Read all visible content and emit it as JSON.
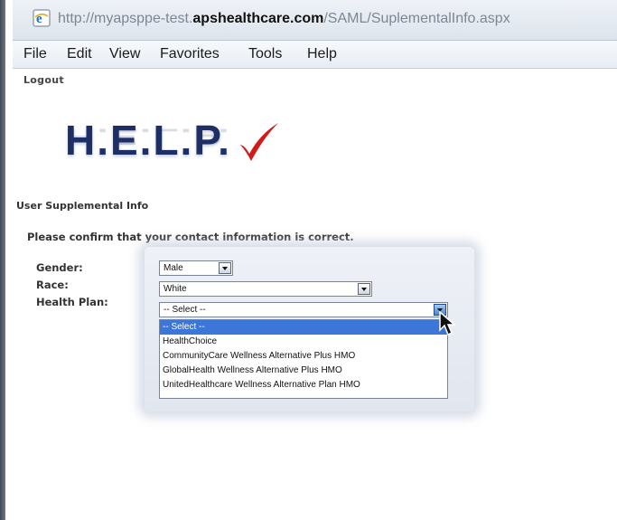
{
  "browser": {
    "url_prefix": "http://myapsppe-test.",
    "url_domain": "apshealthcare.com",
    "url_path": "/SAML/SuplementalInfo.aspx",
    "icon": "ie-page-icon"
  },
  "menubar": {
    "items": [
      "File",
      "Edit",
      "View",
      "Favorites",
      "Tools",
      "Help"
    ]
  },
  "page": {
    "logout_link": "Logout",
    "logo_text": "H.E.L.P.",
    "logo_mark": "red-checkmark-icon",
    "section_title": "User Supplemental Info",
    "instruction": "Please confirm that your contact information is correct."
  },
  "form": {
    "gender": {
      "label": "Gender:",
      "value": "Male"
    },
    "race": {
      "label": "Race:",
      "value": "White"
    },
    "health_plan": {
      "label": "Health Plan:",
      "value": "-- Select --",
      "open": true,
      "options": [
        "-- Select --",
        "HealthChoice",
        "CommunityCare Wellness Alternative Plus HMO",
        "GlobalHealth Wellness Alternative Plus HMO",
        "UnitedHealthcare Wellness Alternative Plan HMO"
      ],
      "highlighted_option": "-- Select --"
    }
  },
  "colors": {
    "logo": "#1d2f66",
    "check": "#d21a1a",
    "selection": "#3c76d8"
  }
}
